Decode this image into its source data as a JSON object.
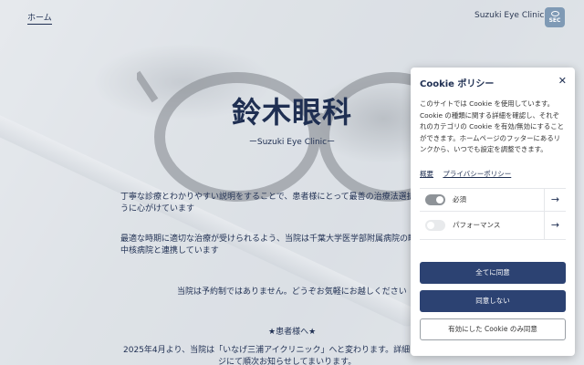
{
  "header": {
    "home_link": "ホーム",
    "clinic_name": "Suzuki Eye Clinic",
    "badge_text": "SEC"
  },
  "main": {
    "title": "鈴木眼科",
    "subtitle": "ーSuzuki Eye Clinicー",
    "paragraphs": [
      "丁寧な診療とわかりやすい説明をすることで、患者様にとって最善の治療法選択",
      "うに心がけています",
      "最適な時期に適切な治療が受けられるよう、当院は千葉大学医学部附属病院の眼",
      "中核病院と連携しています",
      "当院は予約制ではありません。どうぞお気軽にお越しください",
      "★患者様へ★",
      "2025年4月より、当院は「いなげ三浦アイクリニック」へと変わります。詳細",
      "ジにて順次お知らせしてまいります。"
    ]
  },
  "cookie": {
    "title": "Cookie ポリシー",
    "close_icon": "close-icon",
    "description": "このサイトでは Cookie を使用しています。Cookie の種類に関する詳細を確認し、それぞれのカテゴリの Cookie を有効/無効にすることができます。ホームページのフッターにあるリンクから、いつでも設定を調整できます。",
    "links": [
      "概要",
      "プライバシーポリシー"
    ],
    "categories": [
      {
        "label": "必須",
        "enabled": true
      },
      {
        "label": "パフォーマンス",
        "enabled": false
      }
    ],
    "buttons": {
      "accept_all": "全てに同意",
      "reject": "同意しない",
      "accept_selected": "有効にした Cookie のみ同意"
    }
  },
  "colors": {
    "accent": "#2c4272",
    "text_dark": "#1f2f52"
  }
}
